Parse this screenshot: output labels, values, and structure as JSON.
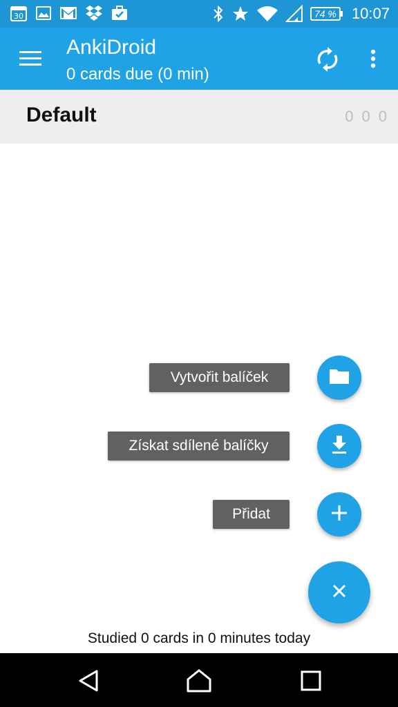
{
  "status_bar": {
    "battery": "74 %",
    "time": "10:07",
    "calendar_day": "30",
    "icons_left": [
      "calendar-icon",
      "image-icon",
      "gmail-icon",
      "dropbox-icon",
      "briefcase-icon"
    ],
    "icons_right": [
      "bluetooth-icon",
      "star-icon",
      "wifi-icon",
      "cell-signal-icon",
      "battery-icon"
    ]
  },
  "app_bar": {
    "title": "AnkiDroid",
    "subtitle": "0 cards due (0 min)",
    "menu_icon": "hamburger-menu-icon",
    "sync_icon": "sync-icon",
    "overflow_icon": "more-vertical-icon"
  },
  "deck": {
    "name": "Default",
    "counts": [
      "0",
      "0",
      "0"
    ]
  },
  "fab_menu": {
    "items": [
      {
        "label": "Vytvořit balíček",
        "icon": "folder-icon"
      },
      {
        "label": "Získat sdílené balíčky",
        "icon": "download-icon"
      },
      {
        "label": "Přidat",
        "icon": "plus-icon"
      }
    ],
    "main_icon": "close-icon"
  },
  "footer": {
    "studied": "Studied 0 cards in 0 minutes today"
  },
  "colors": {
    "status_bar": "#1e96d6",
    "app_bar": "#1fa3e6",
    "fab": "#1fa3e6",
    "fab_label": "#616161",
    "deck_row": "#eeeeee"
  }
}
